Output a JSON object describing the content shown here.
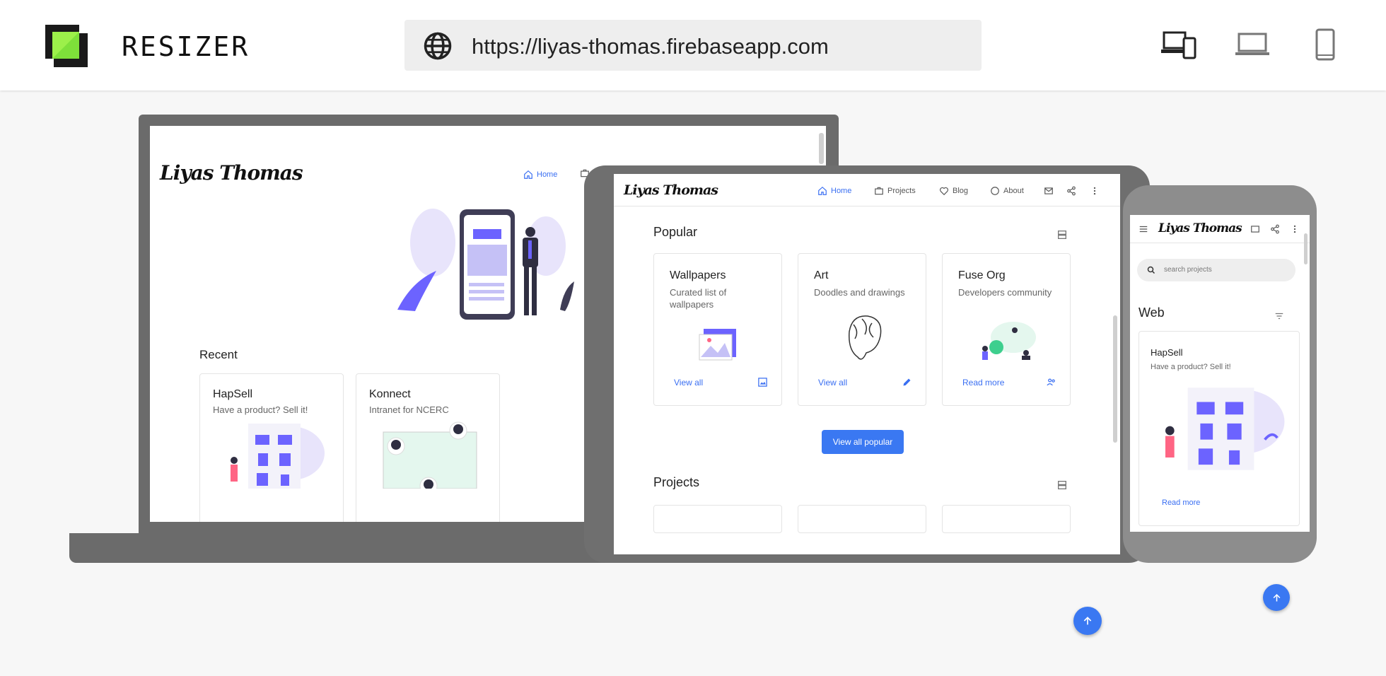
{
  "app": {
    "name": "RESIZER",
    "url": "https://liyas-thomas.firebaseapp.com"
  },
  "devices": {
    "all_icon": "devices-icon",
    "laptop_icon": "laptop-icon",
    "phone_icon": "phone-icon"
  },
  "site": {
    "logo": "Liyas Thomas",
    "nav": {
      "home": "Home",
      "projects": "Projects",
      "blog": "Blog",
      "about": "About"
    },
    "recent": {
      "heading": "Recent",
      "cards": [
        {
          "title": "HapSell",
          "desc": "Have a product? Sell it!"
        },
        {
          "title": "Konnect",
          "desc": "Intranet for NCERC"
        }
      ]
    },
    "popular": {
      "heading": "Popular",
      "cards": [
        {
          "title": "Wallpapers",
          "desc": "Curated list of wallpapers",
          "link": "View all"
        },
        {
          "title": "Art",
          "desc": "Doodles and drawings",
          "link": "View all"
        },
        {
          "title": "Fuse Org",
          "desc": "Developers community",
          "link": "Read more"
        }
      ],
      "button": "View all popular"
    },
    "projects": {
      "heading": "Projects"
    },
    "mobile": {
      "search_placeholder": "search projects",
      "web_heading": "Web",
      "card_title": "HapSell",
      "card_desc": "Have a product? Sell it!",
      "card_link": "Read more"
    }
  },
  "colors": {
    "accent": "#3a78f2",
    "device_frame": "#6b6b6b",
    "illustration": "#6c63ff"
  }
}
